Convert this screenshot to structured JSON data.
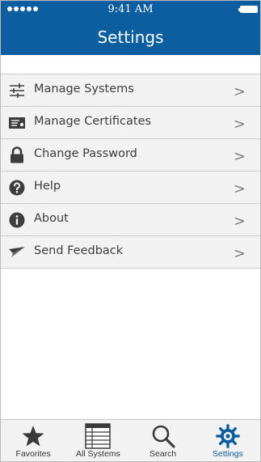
{
  "status_bar": {
    "time": "9:41 AM"
  },
  "header": {
    "title": "Settings"
  },
  "settings_items": [
    {
      "label": "Manage Systems",
      "icon": "sliders-icon"
    },
    {
      "label": "Manage Certificates",
      "icon": "certificate-icon"
    },
    {
      "label": "Change Password",
      "icon": "lock-icon"
    },
    {
      "label": "Help",
      "icon": "question-icon"
    },
    {
      "label": "About",
      "icon": "info-icon"
    },
    {
      "label": "Send Feedback",
      "icon": "paper-plane-icon"
    }
  ],
  "chevron": ">",
  "tabs": [
    {
      "label": "Favorites",
      "icon": "star-icon"
    },
    {
      "label": "All Systems",
      "icon": "list-icon"
    },
    {
      "label": "Search",
      "icon": "magnifier-icon"
    },
    {
      "label": "Settings",
      "icon": "gear-icon",
      "active": true
    }
  ],
  "colors": {
    "header_bg": "#0c5ea1",
    "active_tab": "#0c5ea1",
    "icon_dark": "#3d3d3d"
  }
}
